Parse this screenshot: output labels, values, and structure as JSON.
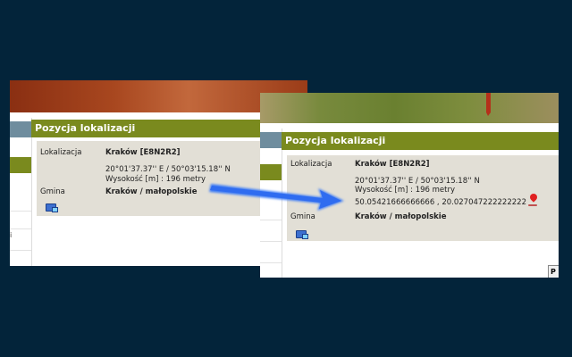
{
  "left_window": {
    "panel_title": "Pozycja lokalizacji",
    "lokalizacja_label": "Lokalizacja",
    "lokalizacja_value": "Kraków [E8N2R2]",
    "coords": "20°01'37.37'' E / 50°03'15.18'' N",
    "altitude": "Wysokość [m] : 196 metry",
    "gmina_label": "Gmina",
    "gmina_value": "Kraków / małopolskie",
    "sidebar_char": "i"
  },
  "right_window": {
    "panel_title": "Pozycja lokalizacji",
    "lokalizacja_label": "Lokalizacja",
    "lokalizacja_value": "Kraków [E8N2R2]",
    "coords": "20°01'37.37'' E / 50°03'15.18'' N",
    "altitude": "Wysokość [m] : 196 metry",
    "decimal_coords": "50.05421666666666 , 20.027047222222222",
    "gmina_label": "Gmina",
    "gmina_value": "Kraków / małopolskie",
    "corner_button": "P"
  },
  "icons": {
    "library": "library-icon",
    "map_pin": "map-pin-icon",
    "arrow": "arrow-icon"
  },
  "colors": {
    "background": "#03243a",
    "panel_header": "#7a8a1e",
    "panel_body": "#e2dfd6",
    "arrow": "#2f6cf0"
  }
}
